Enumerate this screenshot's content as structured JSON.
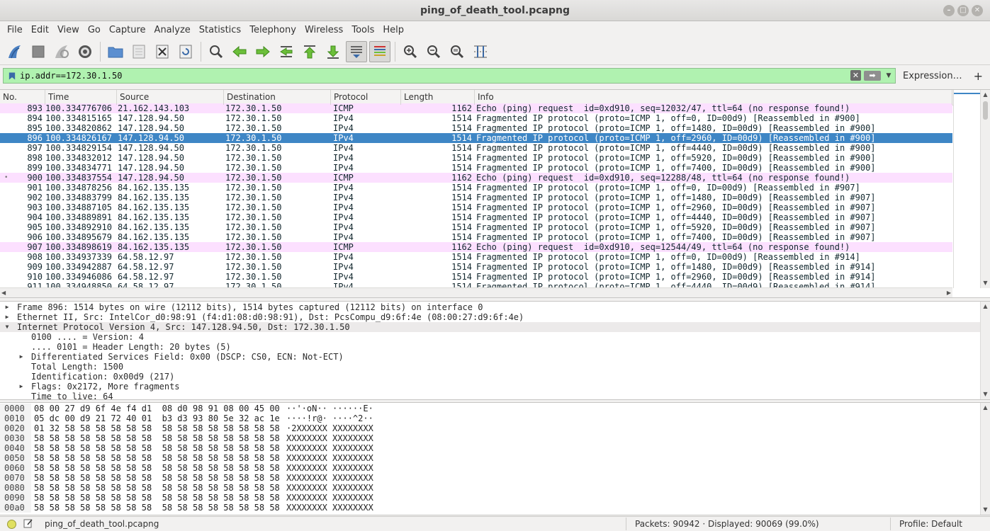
{
  "window": {
    "title": "ping_of_death_tool.pcapng"
  },
  "menu": [
    "File",
    "Edit",
    "View",
    "Go",
    "Capture",
    "Analyze",
    "Statistics",
    "Telephony",
    "Wireless",
    "Tools",
    "Help"
  ],
  "toolbar": {
    "buttons": [
      "start-capture-icon",
      "stop-capture-icon",
      "restart-capture-icon",
      "capture-options-icon",
      "open-file-icon",
      "save-file-icon",
      "close-file-icon",
      "reload-file-icon",
      "find-packet-icon",
      "go-back-icon",
      "go-forward-icon",
      "go-to-packet-icon",
      "go-first-icon",
      "go-last-icon",
      "autoscroll-icon",
      "colorize-icon",
      "zoom-in-icon",
      "zoom-out-icon",
      "zoom-normal-icon",
      "resize-columns-icon"
    ]
  },
  "filter": {
    "value": "ip.addr==172.30.1.50",
    "clear_label": "✕",
    "apply_label": "➡",
    "expression_label": "Expression…",
    "add_label": "+"
  },
  "columns": [
    "No.",
    "Time",
    "Source",
    "Destination",
    "Protocol",
    "Length",
    "Info"
  ],
  "packets": [
    {
      "no": "893",
      "time": "100.334776706",
      "src": "21.162.143.103",
      "dst": "172.30.1.50",
      "proto": "ICMP",
      "len": "1162",
      "info": "Echo (ping) request  id=0xd910, seq=12032/47, ttl=64 (no response found!)",
      "type": "icmp",
      "partial_top": true
    },
    {
      "no": "894",
      "time": "100.334815165",
      "src": "147.128.94.50",
      "dst": "172.30.1.50",
      "proto": "IPv4",
      "len": "1514",
      "info": "Fragmented IP protocol (proto=ICMP 1, off=0, ID=00d9) [Reassembled in #900]",
      "type": "ipv4"
    },
    {
      "no": "895",
      "time": "100.334820862",
      "src": "147.128.94.50",
      "dst": "172.30.1.50",
      "proto": "IPv4",
      "len": "1514",
      "info": "Fragmented IP protocol (proto=ICMP 1, off=1480, ID=00d9) [Reassembled in #900]",
      "type": "ipv4"
    },
    {
      "no": "896",
      "time": "100.334826167",
      "src": "147.128.94.50",
      "dst": "172.30.1.50",
      "proto": "IPv4",
      "len": "1514",
      "info": "Fragmented IP protocol (proto=ICMP 1, off=2960, ID=00d9) [Reassembled in #900]",
      "type": "sel"
    },
    {
      "no": "897",
      "time": "100.334829154",
      "src": "147.128.94.50",
      "dst": "172.30.1.50",
      "proto": "IPv4",
      "len": "1514",
      "info": "Fragmented IP protocol (proto=ICMP 1, off=4440, ID=00d9) [Reassembled in #900]",
      "type": "ipv4"
    },
    {
      "no": "898",
      "time": "100.334832012",
      "src": "147.128.94.50",
      "dst": "172.30.1.50",
      "proto": "IPv4",
      "len": "1514",
      "info": "Fragmented IP protocol (proto=ICMP 1, off=5920, ID=00d9) [Reassembled in #900]",
      "type": "ipv4"
    },
    {
      "no": "899",
      "time": "100.334834771",
      "src": "147.128.94.50",
      "dst": "172.30.1.50",
      "proto": "IPv4",
      "len": "1514",
      "info": "Fragmented IP protocol (proto=ICMP 1, off=7400, ID=00d9) [Reassembled in #900]",
      "type": "ipv4"
    },
    {
      "no": "900",
      "time": "100.334837554",
      "src": "147.128.94.50",
      "dst": "172.30.1.50",
      "proto": "ICMP",
      "len": "1162",
      "info": "Echo (ping) request  id=0xd910, seq=12288/48, ttl=64 (no response found!)",
      "type": "icmp",
      "marker": "•"
    },
    {
      "no": "901",
      "time": "100.334878256",
      "src": "84.162.135.135",
      "dst": "172.30.1.50",
      "proto": "IPv4",
      "len": "1514",
      "info": "Fragmented IP protocol (proto=ICMP 1, off=0, ID=00d9) [Reassembled in #907]",
      "type": "ipv4"
    },
    {
      "no": "902",
      "time": "100.334883799",
      "src": "84.162.135.135",
      "dst": "172.30.1.50",
      "proto": "IPv4",
      "len": "1514",
      "info": "Fragmented IP protocol (proto=ICMP 1, off=1480, ID=00d9) [Reassembled in #907]",
      "type": "ipv4"
    },
    {
      "no": "903",
      "time": "100.334887105",
      "src": "84.162.135.135",
      "dst": "172.30.1.50",
      "proto": "IPv4",
      "len": "1514",
      "info": "Fragmented IP protocol (proto=ICMP 1, off=2960, ID=00d9) [Reassembled in #907]",
      "type": "ipv4"
    },
    {
      "no": "904",
      "time": "100.334889891",
      "src": "84.162.135.135",
      "dst": "172.30.1.50",
      "proto": "IPv4",
      "len": "1514",
      "info": "Fragmented IP protocol (proto=ICMP 1, off=4440, ID=00d9) [Reassembled in #907]",
      "type": "ipv4"
    },
    {
      "no": "905",
      "time": "100.334892910",
      "src": "84.162.135.135",
      "dst": "172.30.1.50",
      "proto": "IPv4",
      "len": "1514",
      "info": "Fragmented IP protocol (proto=ICMP 1, off=5920, ID=00d9) [Reassembled in #907]",
      "type": "ipv4"
    },
    {
      "no": "906",
      "time": "100.334895679",
      "src": "84.162.135.135",
      "dst": "172.30.1.50",
      "proto": "IPv4",
      "len": "1514",
      "info": "Fragmented IP protocol (proto=ICMP 1, off=7400, ID=00d9) [Reassembled in #907]",
      "type": "ipv4"
    },
    {
      "no": "907",
      "time": "100.334898619",
      "src": "84.162.135.135",
      "dst": "172.30.1.50",
      "proto": "ICMP",
      "len": "1162",
      "info": "Echo (ping) request  id=0xd910, seq=12544/49, ttl=64 (no response found!)",
      "type": "icmp"
    },
    {
      "no": "908",
      "time": "100.334937339",
      "src": "64.58.12.97",
      "dst": "172.30.1.50",
      "proto": "IPv4",
      "len": "1514",
      "info": "Fragmented IP protocol (proto=ICMP 1, off=0, ID=00d9) [Reassembled in #914]",
      "type": "ipv4"
    },
    {
      "no": "909",
      "time": "100.334942887",
      "src": "64.58.12.97",
      "dst": "172.30.1.50",
      "proto": "IPv4",
      "len": "1514",
      "info": "Fragmented IP protocol (proto=ICMP 1, off=1480, ID=00d9) [Reassembled in #914]",
      "type": "ipv4"
    },
    {
      "no": "910",
      "time": "100.334946086",
      "src": "64.58.12.97",
      "dst": "172.30.1.50",
      "proto": "IPv4",
      "len": "1514",
      "info": "Fragmented IP protocol (proto=ICMP 1, off=2960, ID=00d9) [Reassembled in #914]",
      "type": "ipv4"
    },
    {
      "no": "911",
      "time": "100.334948850",
      "src": "64.58.12.97",
      "dst": "172.30.1.50",
      "proto": "IPv4",
      "len": "1514",
      "info": "Fragmented IP protocol (proto=ICMP 1, off=4440, ID=00d9) [Reassembled in #914]",
      "type": "ipv4"
    }
  ],
  "details": [
    {
      "text": "Frame 896: 1514 bytes on wire (12112 bits), 1514 bytes captured (12112 bits) on interface 0",
      "toggle": "▶",
      "level": 0
    },
    {
      "text": "Ethernet II, Src: IntelCor_d0:98:91 (f4:d1:08:d0:98:91), Dst: PcsCompu_d9:6f:4e (08:00:27:d9:6f:4e)",
      "toggle": "▶",
      "level": 0
    },
    {
      "text": "Internet Protocol Version 4, Src: 147.128.94.50, Dst: 172.30.1.50",
      "toggle": "▼",
      "level": 0,
      "hl": true
    },
    {
      "text": "0100 .... = Version: 4",
      "toggle": "",
      "level": 1
    },
    {
      "text": ".... 0101 = Header Length: 20 bytes (5)",
      "toggle": "",
      "level": 1
    },
    {
      "text": "Differentiated Services Field: 0x00 (DSCP: CS0, ECN: Not-ECT)",
      "toggle": "▶",
      "level": 1
    },
    {
      "text": "Total Length: 1500",
      "toggle": "",
      "level": 1
    },
    {
      "text": "Identification: 0x00d9 (217)",
      "toggle": "",
      "level": 1
    },
    {
      "text": "Flags: 0x2172, More fragments",
      "toggle": "▶",
      "level": 1
    },
    {
      "text": "Time to live: 64",
      "toggle": "",
      "level": 1
    }
  ],
  "hexdump": [
    {
      "off": "0000",
      "bytes": "08 00 27 d9 6f 4e f4 d1  08 d0 98 91 08 00 45 00",
      "ascii": "··'·oN·· ······E·"
    },
    {
      "off": "0010",
      "bytes": "05 dc 00 d9 21 72 40 01  b3 d3 93 80 5e 32 ac 1e",
      "ascii": "····!r@· ····^2··"
    },
    {
      "off": "0020",
      "bytes": "01 32 58 58 58 58 58 58  58 58 58 58 58 58 58 58",
      "ascii": "·2XXXXXX XXXXXXXX"
    },
    {
      "off": "0030",
      "bytes": "58 58 58 58 58 58 58 58  58 58 58 58 58 58 58 58",
      "ascii": "XXXXXXXX XXXXXXXX"
    },
    {
      "off": "0040",
      "bytes": "58 58 58 58 58 58 58 58  58 58 58 58 58 58 58 58",
      "ascii": "XXXXXXXX XXXXXXXX"
    },
    {
      "off": "0050",
      "bytes": "58 58 58 58 58 58 58 58  58 58 58 58 58 58 58 58",
      "ascii": "XXXXXXXX XXXXXXXX"
    },
    {
      "off": "0060",
      "bytes": "58 58 58 58 58 58 58 58  58 58 58 58 58 58 58 58",
      "ascii": "XXXXXXXX XXXXXXXX"
    },
    {
      "off": "0070",
      "bytes": "58 58 58 58 58 58 58 58  58 58 58 58 58 58 58 58",
      "ascii": "XXXXXXXX XXXXXXXX"
    },
    {
      "off": "0080",
      "bytes": "58 58 58 58 58 58 58 58  58 58 58 58 58 58 58 58",
      "ascii": "XXXXXXXX XXXXXXXX"
    },
    {
      "off": "0090",
      "bytes": "58 58 58 58 58 58 58 58  58 58 58 58 58 58 58 58",
      "ascii": "XXXXXXXX XXXXXXXX"
    },
    {
      "off": "00a0",
      "bytes": "58 58 58 58 58 58 58 58  58 58 58 58 58 58 58 58",
      "ascii": "XXXXXXXX XXXXXXXX"
    }
  ],
  "status": {
    "file": "ping_of_death_tool.pcapng",
    "packets": "Packets: 90942 · Displayed: 90069 (99.0%)",
    "profile": "Profile: Default"
  },
  "colors": {
    "icmp_row": "#fce0ff",
    "selected_row": "#3e86c5",
    "filter_valid": "#b0f2b0"
  }
}
